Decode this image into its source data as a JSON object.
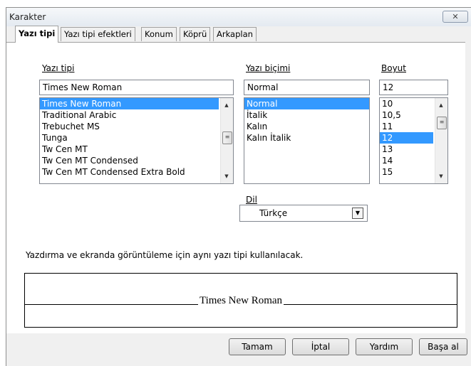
{
  "window": {
    "title": "Karakter",
    "close_glyph": "✕"
  },
  "tabs": [
    {
      "label": "Yazı tipi",
      "active": true
    },
    {
      "label": "Yazı tipi efektleri",
      "active": false
    },
    {
      "label": "Konum",
      "active": false
    },
    {
      "label": "Köprü",
      "active": false
    },
    {
      "label": "Arkaplan",
      "active": false
    }
  ],
  "font": {
    "label": "Yazı tipi",
    "value": "Times New Roman",
    "items": [
      "Times New Roman",
      "Traditional Arabic",
      "Trebuchet MS",
      "Tunga",
      "Tw Cen MT",
      "Tw Cen MT Condensed",
      "Tw Cen MT Condensed Extra Bold"
    ],
    "selected": "Times New Roman"
  },
  "style": {
    "label": "Yazı biçimi",
    "value": "Normal",
    "items": [
      "Normal",
      "İtalik",
      "Kalın",
      "Kalın İtalik"
    ],
    "selected": "Normal"
  },
  "size": {
    "label": "Boyut",
    "value": "12",
    "items": [
      "10",
      "10,5",
      "11",
      "12",
      "13",
      "14",
      "15"
    ],
    "selected": "12"
  },
  "language": {
    "label": "Dil",
    "value": "Türkçe"
  },
  "info_text": "Yazdırma ve ekranda görüntüleme için aynı yazı tipi kullanılacak.",
  "preview_text": "Times New Roman",
  "buttons": {
    "ok": "Tamam",
    "cancel": "İptal",
    "help": "Yardım",
    "reset": "Başa al"
  },
  "colors": {
    "selection": "#3399ff"
  },
  "icons": {
    "scroll_up": "arrow-up-icon",
    "scroll_down": "arrow-down-icon",
    "dropdown": "chevron-down-icon"
  }
}
